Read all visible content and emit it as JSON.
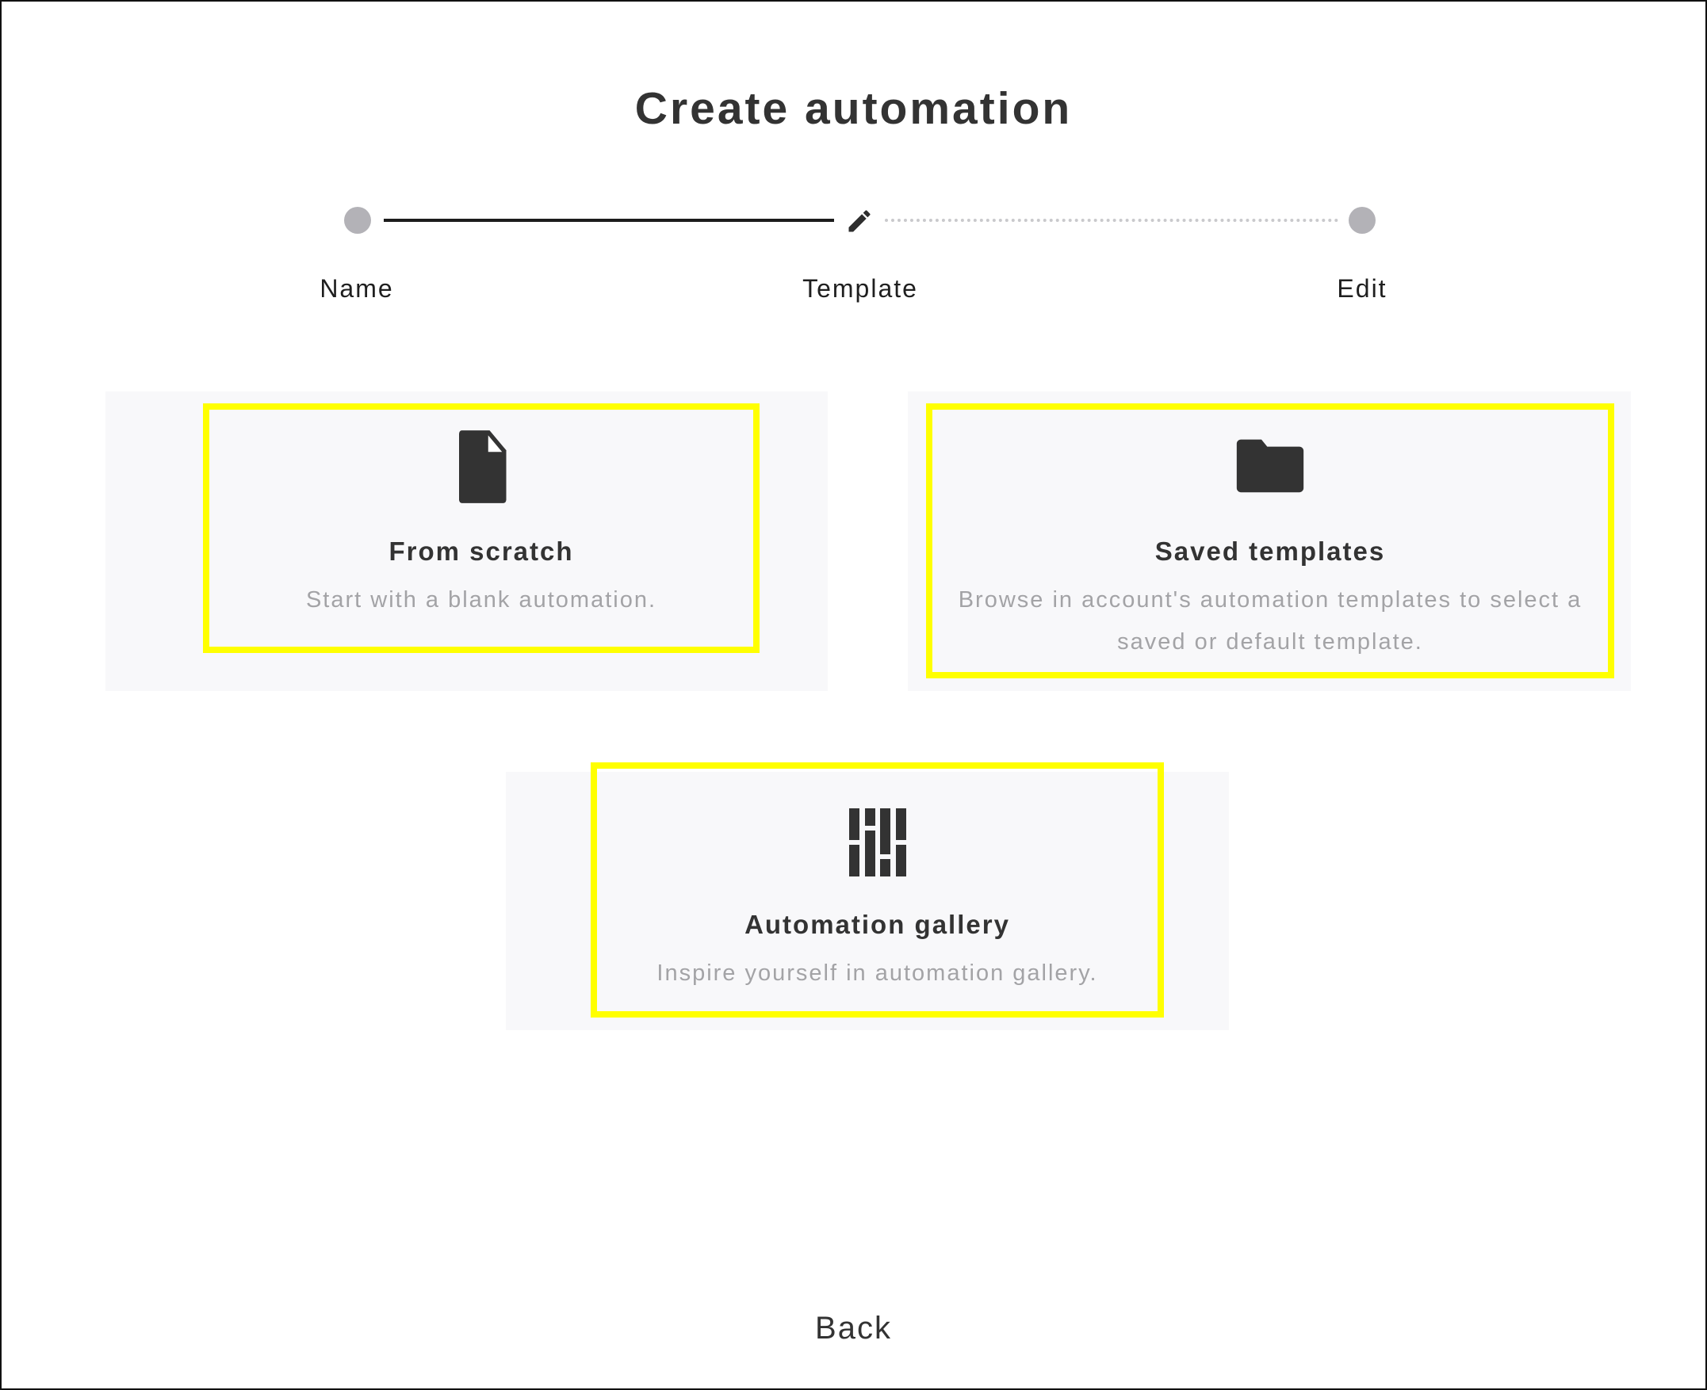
{
  "page": {
    "title": "Create automation"
  },
  "stepper": {
    "steps": [
      {
        "label": "Name",
        "state": "completed"
      },
      {
        "label": "Template",
        "state": "active",
        "icon": "pencil-icon"
      },
      {
        "label": "Edit",
        "state": "pending"
      }
    ]
  },
  "options": [
    {
      "title": "From scratch",
      "description": "Start with a blank automation.",
      "icon": "file-icon"
    },
    {
      "title": "Saved templates",
      "description": "Browse in account's automation templates to select a saved or default template.",
      "icon": "folder-icon"
    },
    {
      "title": "Automation gallery",
      "description": "Inspire yourself in automation gallery.",
      "icon": "gallery-icon"
    }
  ],
  "footer": {
    "back_label": "Back"
  },
  "colors": {
    "highlight": "#ffff00",
    "card_background": "#f8f8fa",
    "step_dot": "#b3b2b7",
    "text_dark": "#333333",
    "text_muted": "#a3a3a6"
  }
}
